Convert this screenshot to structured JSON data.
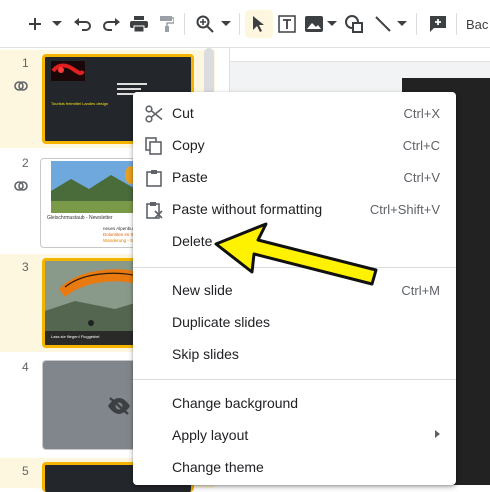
{
  "toolbar": {
    "items": [
      "new-slide",
      "undo",
      "redo",
      "print",
      "paint-format",
      "zoom",
      "select",
      "text-box",
      "image",
      "shape",
      "line",
      "comment"
    ],
    "truncated_label": "Bac"
  },
  "filmstrip": {
    "slides": [
      {
        "number": "1",
        "linked": true,
        "selected": true,
        "caption": "Tourists freimittel Landes design"
      },
      {
        "number": "2",
        "linked": true,
        "selected": false,
        "caption": "Gleischrmustaub - Newsletter",
        "subcaption": "neues Alpenbuch Englisch",
        "subcaption2": "Dolomiten im September",
        "subcaption3": "Wanderung - Sommer im Nordt"
      },
      {
        "number": "3",
        "linked": false,
        "selected": true,
        "caption": "Lass sie fliegen! Fluggebiet"
      },
      {
        "number": "4",
        "linked": false,
        "selected": false,
        "hidden": true
      },
      {
        "number": "5",
        "linked": false,
        "selected": true
      }
    ]
  },
  "context_menu": {
    "items": [
      {
        "label": "Cut",
        "shortcut": "Ctrl+X",
        "icon": "scissors-icon"
      },
      {
        "label": "Copy",
        "shortcut": "Ctrl+C",
        "icon": "copy-icon"
      },
      {
        "label": "Paste",
        "shortcut": "Ctrl+V",
        "icon": "clipboard-icon"
      },
      {
        "label": "Paste without formatting",
        "shortcut": "Ctrl+Shift+V",
        "icon": "paste-plain-icon"
      },
      {
        "label": "Delete",
        "shortcut": ""
      },
      {
        "label": "New slide",
        "shortcut": "Ctrl+M"
      },
      {
        "label": "Duplicate slides",
        "shortcut": ""
      },
      {
        "label": "Skip slides",
        "shortcut": ""
      },
      {
        "label": "Change background",
        "shortcut": ""
      },
      {
        "label": "Apply layout",
        "shortcut": "",
        "submenu": true
      },
      {
        "label": "Change theme",
        "shortcut": ""
      }
    ]
  },
  "colors": {
    "selection_border": "#f4b400",
    "selection_bg": "#fef7e0",
    "annotation_arrow": "#fff200"
  }
}
